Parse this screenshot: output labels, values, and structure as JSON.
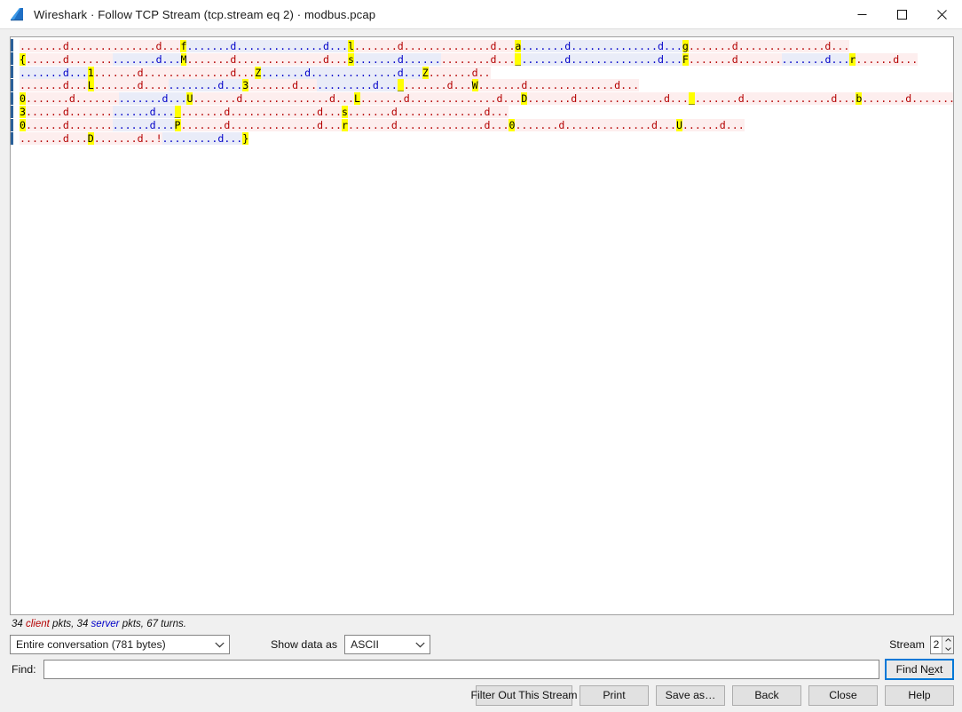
{
  "window": {
    "title": "Wireshark · Follow TCP Stream (tcp.stream eq 2) · modbus.pcap",
    "app_icon": "wireshark-fin-icon",
    "minimize_label": "Minimize",
    "maximize_label": "Maximize",
    "close_label": "Close"
  },
  "stream": {
    "lines": [
      {
        "id": "line-1",
        "marker": "",
        "segments": [
          {
            "side": "client",
            "text": ".......d..............d...",
            "hl_last": false
          },
          {
            "side": "client",
            "text": "f",
            "hl": true
          },
          {
            "side": "server",
            "text": ".......d..............d...",
            "hl_last": false
          },
          {
            "side": "server",
            "text": "l",
            "hl": true
          },
          {
            "side": "client",
            "text": ".......d..............d...",
            "hl_last": false
          },
          {
            "side": "client",
            "text": "a",
            "hl": true
          },
          {
            "side": "server",
            "text": ".......d..............d...",
            "hl_last": false
          },
          {
            "side": "server",
            "text": "g",
            "hl": true
          },
          {
            "side": "client",
            "text": ".......d..............d...",
            "hl_last": false
          }
        ]
      },
      {
        "id": "line-2",
        "marker": "{",
        "segments": [
          {
            "side": "client",
            "text": "......d.......",
            "hl_last": false
          },
          {
            "side": "server",
            "text": ".......d...",
            "hl_last": false
          },
          {
            "side": "server",
            "text": "M",
            "hl": true
          },
          {
            "side": "client",
            "text": ".......d..............d...",
            "hl_last": false
          },
          {
            "side": "server",
            "text": "s",
            "hl": true
          },
          {
            "side": "server",
            "text": ".......d......",
            "hl_last": false
          },
          {
            "side": "client",
            "text": "........d...",
            "hl_last": false
          },
          {
            "side": "client",
            "text": "_",
            "hl": true
          },
          {
            "side": "server",
            "text": ".......d..............d...",
            "hl_last": false
          },
          {
            "side": "server",
            "text": "F",
            "hl": true
          },
          {
            "side": "client",
            "text": ".......d.......",
            "hl_last": false
          },
          {
            "side": "server",
            "text": ".......d...",
            "hl_last": false
          },
          {
            "side": "server",
            "text": "r",
            "hl": true
          },
          {
            "side": "client",
            "text": "......d...",
            "hl_last": false
          }
        ]
      },
      {
        "id": "line-3",
        "marker": "",
        "segments": [
          {
            "side": "server",
            "text": ".......d...",
            "hl_last": false
          },
          {
            "side": "server",
            "text": "1",
            "hl": true
          },
          {
            "side": "client",
            "text": ".......d..............d...",
            "hl_last": false
          },
          {
            "side": "server",
            "text": "Z",
            "hl": true
          },
          {
            "side": "server",
            "text": ".......d..............d...",
            "hl_last": false
          },
          {
            "side": "client",
            "text": "Z",
            "hl": true
          },
          {
            "side": "client",
            "text": ".......d..",
            "hl_last": false
          }
        ]
      },
      {
        "id": "line-4",
        "marker": "",
        "segments": [
          {
            "side": "client",
            "text": ".......d...",
            "hl_last": false
          },
          {
            "side": "client",
            "text": "L",
            "hl": true
          },
          {
            "side": "client",
            "text": ".......d....",
            "hl_last": false
          },
          {
            "side": "server",
            "text": "........d...",
            "hl_last": false
          },
          {
            "side": "server",
            "text": "3",
            "hl": true
          },
          {
            "side": "client",
            "text": ".......d...",
            "hl_last": false
          },
          {
            "side": "server",
            "text": ".........d...",
            "hl_last": false
          },
          {
            "side": "server",
            "text": "_",
            "hl": true
          },
          {
            "side": "client",
            "text": ".......d...",
            "hl_last": false
          },
          {
            "side": "server",
            "text": "W",
            "hl": true
          },
          {
            "side": "client",
            "text": ".......d..............d...",
            "hl_last": false
          }
        ]
      },
      {
        "id": "line-5",
        "marker": "0",
        "segments": [
          {
            "side": "client",
            "text": ".......d.......",
            "hl_last": false
          },
          {
            "side": "server",
            "text": ".......d...",
            "hl_last": false
          },
          {
            "side": "server",
            "text": "U",
            "hl": true
          },
          {
            "side": "client",
            "text": ".......d..............d...",
            "hl_last": false
          },
          {
            "side": "server",
            "text": "L",
            "hl": true
          },
          {
            "side": "client",
            "text": ".......d..............d...",
            "hl_last": false
          },
          {
            "side": "server",
            "text": "D",
            "hl": true
          },
          {
            "side": "client",
            "text": ".......d..............d...",
            "hl_last": false
          },
          {
            "side": "server",
            "text": "_",
            "hl": true
          },
          {
            "side": "client",
            "text": ".......d..............d...",
            "hl_last": false
          },
          {
            "side": "server",
            "text": "b",
            "hl": true
          },
          {
            "side": "client",
            "text": ".......d..............d...",
            "hl_last": false
          }
        ]
      },
      {
        "id": "line-6",
        "marker": "3",
        "segments": [
          {
            "side": "client",
            "text": "......d.......",
            "hl_last": false
          },
          {
            "side": "server",
            "text": "......d...",
            "hl_last": false
          },
          {
            "side": "server",
            "text": "_",
            "hl": true
          },
          {
            "side": "client",
            "text": ".......d..............d...",
            "hl_last": false
          },
          {
            "side": "server",
            "text": "s",
            "hl": true
          },
          {
            "side": "client",
            "text": ".......d..............d...",
            "hl_last": false
          }
        ]
      },
      {
        "id": "line-7",
        "marker": "0",
        "segments": [
          {
            "side": "client",
            "text": "......d.......",
            "hl_last": false
          },
          {
            "side": "server",
            "text": "......d...",
            "hl_last": false
          },
          {
            "side": "server",
            "text": "P",
            "hl": true
          },
          {
            "side": "client",
            "text": ".......d..............d...",
            "hl_last": false
          },
          {
            "side": "server",
            "text": "r",
            "hl": true
          },
          {
            "side": "client",
            "text": ".......d..............d...",
            "hl_last": false
          },
          {
            "side": "server",
            "text": "0",
            "hl": true
          },
          {
            "side": "client",
            "text": ".......d..............d...",
            "hl_last": false
          },
          {
            "side": "server",
            "text": "U",
            "hl": true
          },
          {
            "side": "client",
            "text": "......d...",
            "hl_last": false
          }
        ]
      },
      {
        "id": "line-8",
        "marker": "",
        "segments": [
          {
            "side": "client",
            "text": ".......d...",
            "hl_last": false
          },
          {
            "side": "client",
            "text": "D",
            "hl": true
          },
          {
            "side": "client",
            "text": ".......d..!",
            "hl_last": false
          },
          {
            "side": "server",
            "text": ".........d...",
            "hl_last": false
          },
          {
            "side": "server",
            "text": "}",
            "hl": true
          }
        ]
      }
    ]
  },
  "status": {
    "prefix": "",
    "client_count": "34",
    "client_word": "client",
    "client_suffix": " pkts, ",
    "server_count": "34",
    "server_word": "server",
    "server_suffix": " pkts, ",
    "turns": "67 turns."
  },
  "controls": {
    "conversation_selected": "Entire conversation (781 bytes)",
    "show_data_label": "Show data as",
    "show_data_selected": "ASCII",
    "stream_label": "Stream",
    "stream_value": "2",
    "chevron_icon": "chevron-down-icon",
    "spin_up_icon": "spinner-up-icon",
    "spin_down_icon": "spinner-down-icon"
  },
  "find": {
    "label": "Find:",
    "value": "",
    "placeholder": "",
    "next_before": "Find N",
    "next_accel": "e",
    "next_after": "xt"
  },
  "buttons": {
    "filter_out": "Filter Out This Stream",
    "print": "Print",
    "save_as": "Save as…",
    "back": "Back",
    "close": "Close",
    "help": "Help"
  },
  "colors": {
    "client_text": "#b40000",
    "client_bg": "#fdeeee",
    "server_text": "#0000c8",
    "server_bg": "#e9ecf8",
    "highlight": "#ffff00",
    "focus_border": "#0078d7",
    "selection_bar": "#2a6099"
  }
}
